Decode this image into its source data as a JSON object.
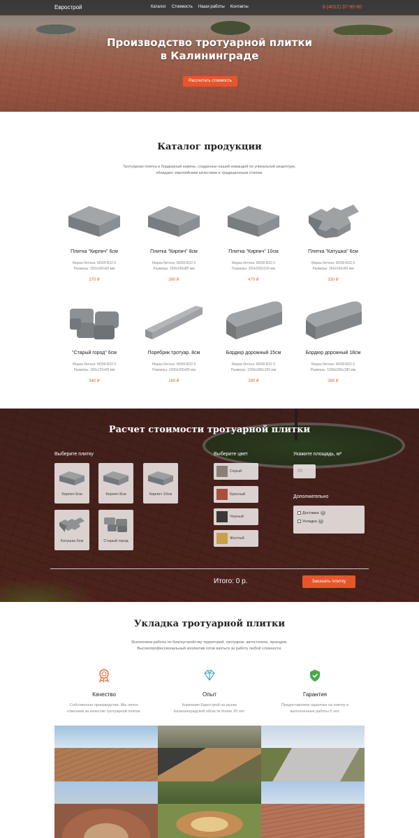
{
  "header": {
    "logo": "Еврострой",
    "menu": [
      "Каталог",
      "Стоимость",
      "Наши работы",
      "Контакты"
    ],
    "phone": "8 (4012) 37-90-60"
  },
  "hero": {
    "title_line1": "Производство тротуарной плитки",
    "title_line2": "в Калининграде",
    "button": "Рассчитать стоимость"
  },
  "catalog": {
    "title": "Каталог продукции",
    "desc_line1": "Тротуарная плитка и бордюрный камень, созданные нашей командой по уникальной рецептуре,",
    "desc_line2": "обладают европейским качеством и традиционным стилем.",
    "products": [
      {
        "name": "Плитка \"Кирпич\" 6см",
        "grade": "Марка бетона: М300-В22.5",
        "size": "Размеры: 200х100х60 мм",
        "price": "370 ₽",
        "shape": "brick"
      },
      {
        "name": "Плитка \"Кирпич\" 8см",
        "grade": "Марка бетона: М300-В22.5",
        "size": "Размеры: 200х100х80 мм",
        "price": "380 ₽",
        "shape": "brick"
      },
      {
        "name": "Плитка \"Кирпич\" 10см",
        "grade": "Марка бетона: М300-В22.5",
        "size": "Размеры: 200х100х100 мм",
        "price": "470 ₽",
        "shape": "brick"
      },
      {
        "name": "Плитка \"Катушка\" 6см",
        "grade": "Марка бетона: М300-В22.5",
        "size": "Размеры: 260х160х60 мм",
        "price": "330 ₽",
        "shape": "spool"
      },
      {
        "name": "\"Старый город\" 6см",
        "grade": "Марка бетона: М300-В22.5",
        "size": "Размеры: 180х120х60 мм",
        "price": "340 ₽",
        "shape": "oldtown"
      },
      {
        "name": "Поребрик тротуар. 8см",
        "grade": "Марка бетона: М300-В22.5",
        "size": "Размеры: 1000х200х80 мм",
        "price": "160 ₽",
        "shape": "curb"
      },
      {
        "name": "Бордюр дорожный 15см",
        "grade": "Марка бетона: М300-В22.5",
        "size": "Размеры: 1000х300х150 мм",
        "price": "280 ₽",
        "shape": "border"
      },
      {
        "name": "Бордюр дорожный 18см",
        "grade": "Марка бетона: М300-В22.5",
        "size": "Размеры: 1000х300х180 мм",
        "price": "360 ₽",
        "shape": "border"
      }
    ]
  },
  "calculator": {
    "title": "Расчет стоимости тротуарной плитки",
    "choose_tile": "Выберите плитку",
    "tiles": [
      "Кирпич 6см",
      "Кирпич 8см",
      "Кирпич 10см",
      "Катушка 6см",
      "Старый город"
    ],
    "choose_color": "Выберите цвет",
    "colors": [
      {
        "name": "Серый",
        "hex": "#8a7f77"
      },
      {
        "name": "Красный",
        "hex": "#a8503c"
      },
      {
        "name": "Черный",
        "hex": "#3a3836"
      },
      {
        "name": "Желтый",
        "hex": "#c9a04a"
      }
    ],
    "area_label": "Укажите площадь, м²",
    "area_value": "20",
    "extra_label": "Дополнительно",
    "extras": [
      "Доставка",
      "Укладка"
    ],
    "extra_hint": "?",
    "total": "Итого: 0 р.",
    "order_button": "Заказать плитку"
  },
  "works": {
    "title": "Укладка тротуарной плитки",
    "desc_line1": "Выполняем работы по благоустройству территорий, тротуаров, автостоянок, проездов.",
    "desc_line2": "Высокопрофессиональный коллектив готов взяться за работу любой сложности.",
    "features": [
      {
        "title": "Качество",
        "text1": "Собственное производство. Мы лично",
        "text2": "отвечаем за качество тротуарной плитки.",
        "icon": "medal-icon",
        "color": "#e36a3c"
      },
      {
        "title": "Опыт",
        "text1": "Компания Еврострой на рынке",
        "text2": "Калининградской области более 20 лет.",
        "icon": "diamond-icon",
        "color": "#3aa3c9"
      },
      {
        "title": "Гарантия",
        "text1": "Предоставляем гарантию на плитку и",
        "text2": "выполненные работы 5 лет.",
        "icon": "shield-icon",
        "color": "#49a84a"
      }
    ]
  },
  "colors": {
    "accent": "#e8552b",
    "price": "#e36a3c"
  }
}
